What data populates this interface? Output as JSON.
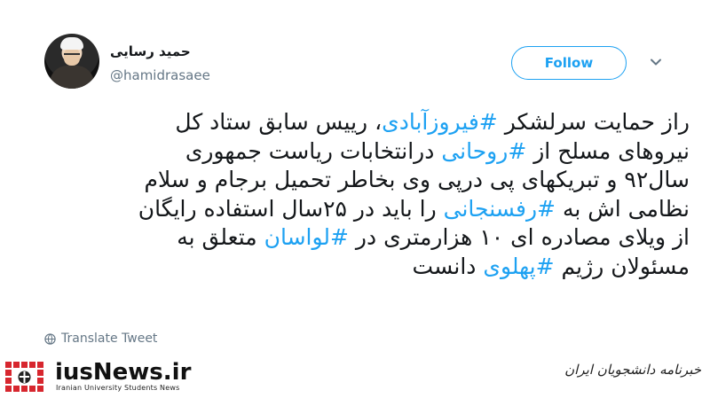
{
  "author": {
    "display_name": "حمید رسایی",
    "handle": "@hamidrasaee"
  },
  "actions": {
    "follow_label": "Follow",
    "more_icon": "chevron-down-icon"
  },
  "tweet": {
    "lines": [
      [
        {
          "t": "راز حمایت سرلشکر "
        },
        {
          "t": "#فیروزآبادی",
          "tag": true
        },
        {
          "t": "، رییس سابق ستاد کل"
        }
      ],
      [
        {
          "t": "نیروهای مسلح از "
        },
        {
          "t": "#روحانی",
          "tag": true
        },
        {
          "t": " درانتخابات ریاست جمهوری"
        }
      ],
      [
        {
          "t": "سال۹۲ و تبریکهای پی درپی وی بخاطر تحمیل برجام و سلام"
        }
      ],
      [
        {
          "t": "نظامی اش به "
        },
        {
          "t": "#رفسنجانی",
          "tag": true
        },
        {
          "t": " را باید در ۲۵سال استفاده رایگان"
        }
      ],
      [
        {
          "t": "از ویلای مصادره ای ۱۰ هزارمتری در "
        },
        {
          "t": "#لواسان",
          "tag": true
        },
        {
          "t": " متعلق  به"
        }
      ],
      [
        {
          "t": "مسئولان رژیم "
        },
        {
          "t": "#پهلوی",
          "tag": true
        },
        {
          "t": " دانست"
        }
      ]
    ]
  },
  "translate": {
    "label": "Translate Tweet",
    "icon": "globe-icon"
  },
  "watermark": {
    "brand_name": "iusNews.ir",
    "brand_tagline": "Iranian University Students News",
    "agency_name": "خبرنامه دانشجویان ایران"
  },
  "colors": {
    "accent": "#1da1f2",
    "text": "#14171a",
    "muted": "#657786",
    "logo_red": "#d7262e"
  }
}
